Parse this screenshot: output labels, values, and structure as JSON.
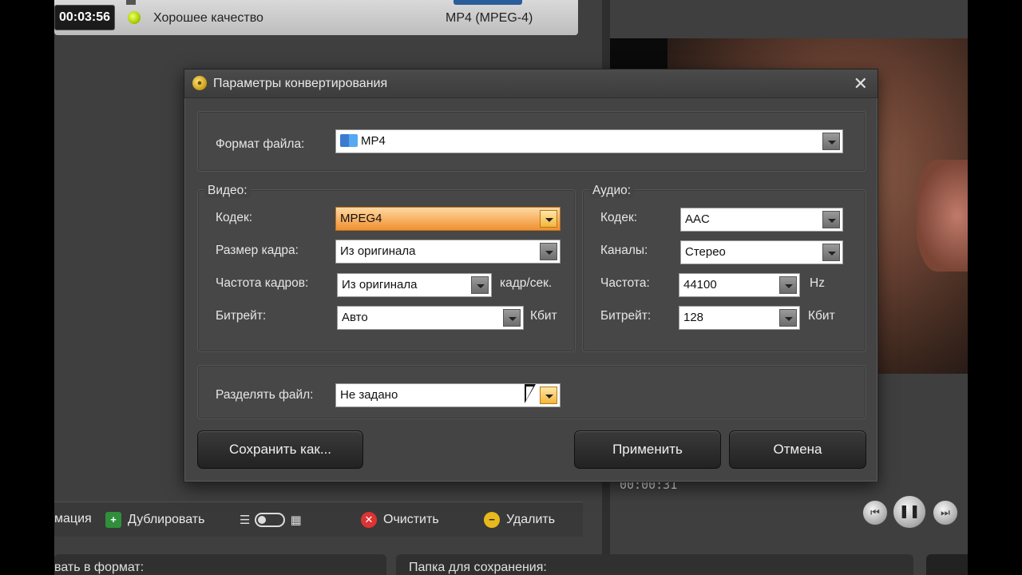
{
  "background": {
    "time_badge": "00:03:56",
    "quality_label": "Хорошее качество",
    "format_label": "MP4 (MPEG-4)",
    "playback_time": "00:00:31",
    "toolbar": {
      "animation_label": "мация",
      "duplicate_label": "Дублировать",
      "clear_label": "Очистить",
      "delete_label": "Удалить"
    },
    "bottom_left_label": "вать в формат:",
    "bottom_right_label": "Папка для сохранения:"
  },
  "dialog": {
    "title": "Параметры конвертирования",
    "close_glyph": "✕",
    "file_format": {
      "label": "Формат файла:",
      "value": "MP4"
    },
    "video": {
      "title": "Видео:",
      "codec": {
        "label": "Кодек:",
        "value": "MPEG4"
      },
      "frame_size": {
        "label": "Размер кадра:",
        "value": "Из оригинала"
      },
      "frame_rate": {
        "label": "Частота кадров:",
        "value": "Из оригинала",
        "unit": "кадр/сек."
      },
      "bitrate": {
        "label": "Битрейт:",
        "value": "Авто",
        "unit": "Кбит"
      }
    },
    "audio": {
      "title": "Аудио:",
      "codec": {
        "label": "Кодек:",
        "value": "AAC"
      },
      "channels": {
        "label": "Каналы:",
        "value": "Стерео"
      },
      "frequency": {
        "label": "Частота:",
        "value": "44100",
        "unit": "Hz"
      },
      "bitrate": {
        "label": "Битрейт:",
        "value": "128",
        "unit": "Кбит"
      }
    },
    "split": {
      "label": "Разделять файл:",
      "value": "Не задано"
    },
    "buttons": {
      "save_as": "Сохранить как...",
      "apply": "Применить",
      "cancel": "Отмена"
    }
  }
}
